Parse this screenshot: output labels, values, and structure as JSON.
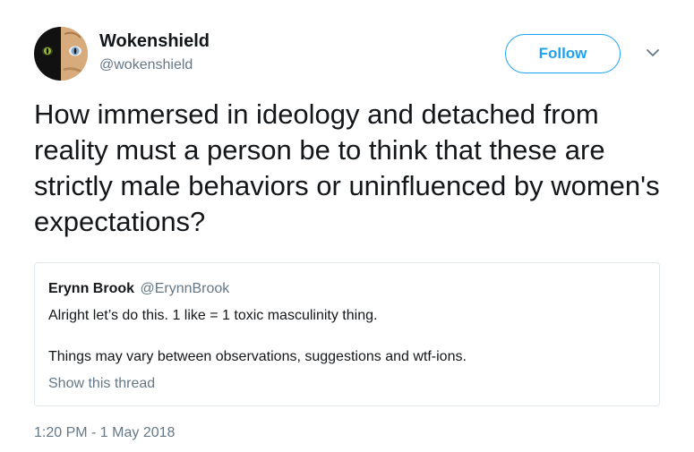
{
  "author": {
    "display_name": "Wokenshield",
    "handle": "@wokenshield",
    "avatar_icon": "cat-face-avatar"
  },
  "actions": {
    "follow_label": "Follow",
    "more_icon": "chevron-down-icon"
  },
  "tweet": {
    "text": "How immersed in ideology and detached from reality must a person be to think that these are strictly male behaviors or uninfluenced by women's expectations?",
    "timestamp": "1:20 PM - 1 May 2018"
  },
  "quoted_tweet": {
    "display_name": "Erynn Brook",
    "handle": "@ErynnBrook",
    "line1": "Alright let’s do this. 1 like = 1 toxic masculinity thing.",
    "line2": "Things may vary between observations, suggestions and wtf-ions.",
    "show_thread_label": "Show this thread"
  },
  "colors": {
    "accent": "#1da1f2",
    "secondary_text": "#657786",
    "border": "#e1e8ed"
  }
}
